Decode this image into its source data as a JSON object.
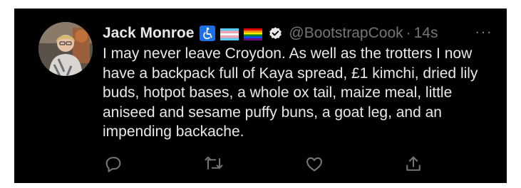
{
  "tweet": {
    "author_name": "Jack Monroe",
    "badges": [
      "wheelchair-icon",
      "trans-flag-icon",
      "rainbow-flag-icon"
    ],
    "verified": "verified-badge-icon",
    "handle": "@BootstrapCook",
    "separator": "·",
    "timestamp": "14s",
    "more_label": "···",
    "text": "I may never leave Croydon. As well as the trotters I now have a backpack full of Kaya spread, £1 kimchi, dried lily buds, hotpot bases, a whole ox tail, maize meal, little aniseed and sesame puffy buns, a goat leg, and an impending backache."
  },
  "actions": [
    "reply-icon",
    "retweet-icon",
    "like-icon",
    "share-icon"
  ],
  "colors": {
    "background": "#000000",
    "text": "#e7e9ea",
    "muted": "#71767b",
    "accessibility_blue": "#1d6fe6"
  }
}
